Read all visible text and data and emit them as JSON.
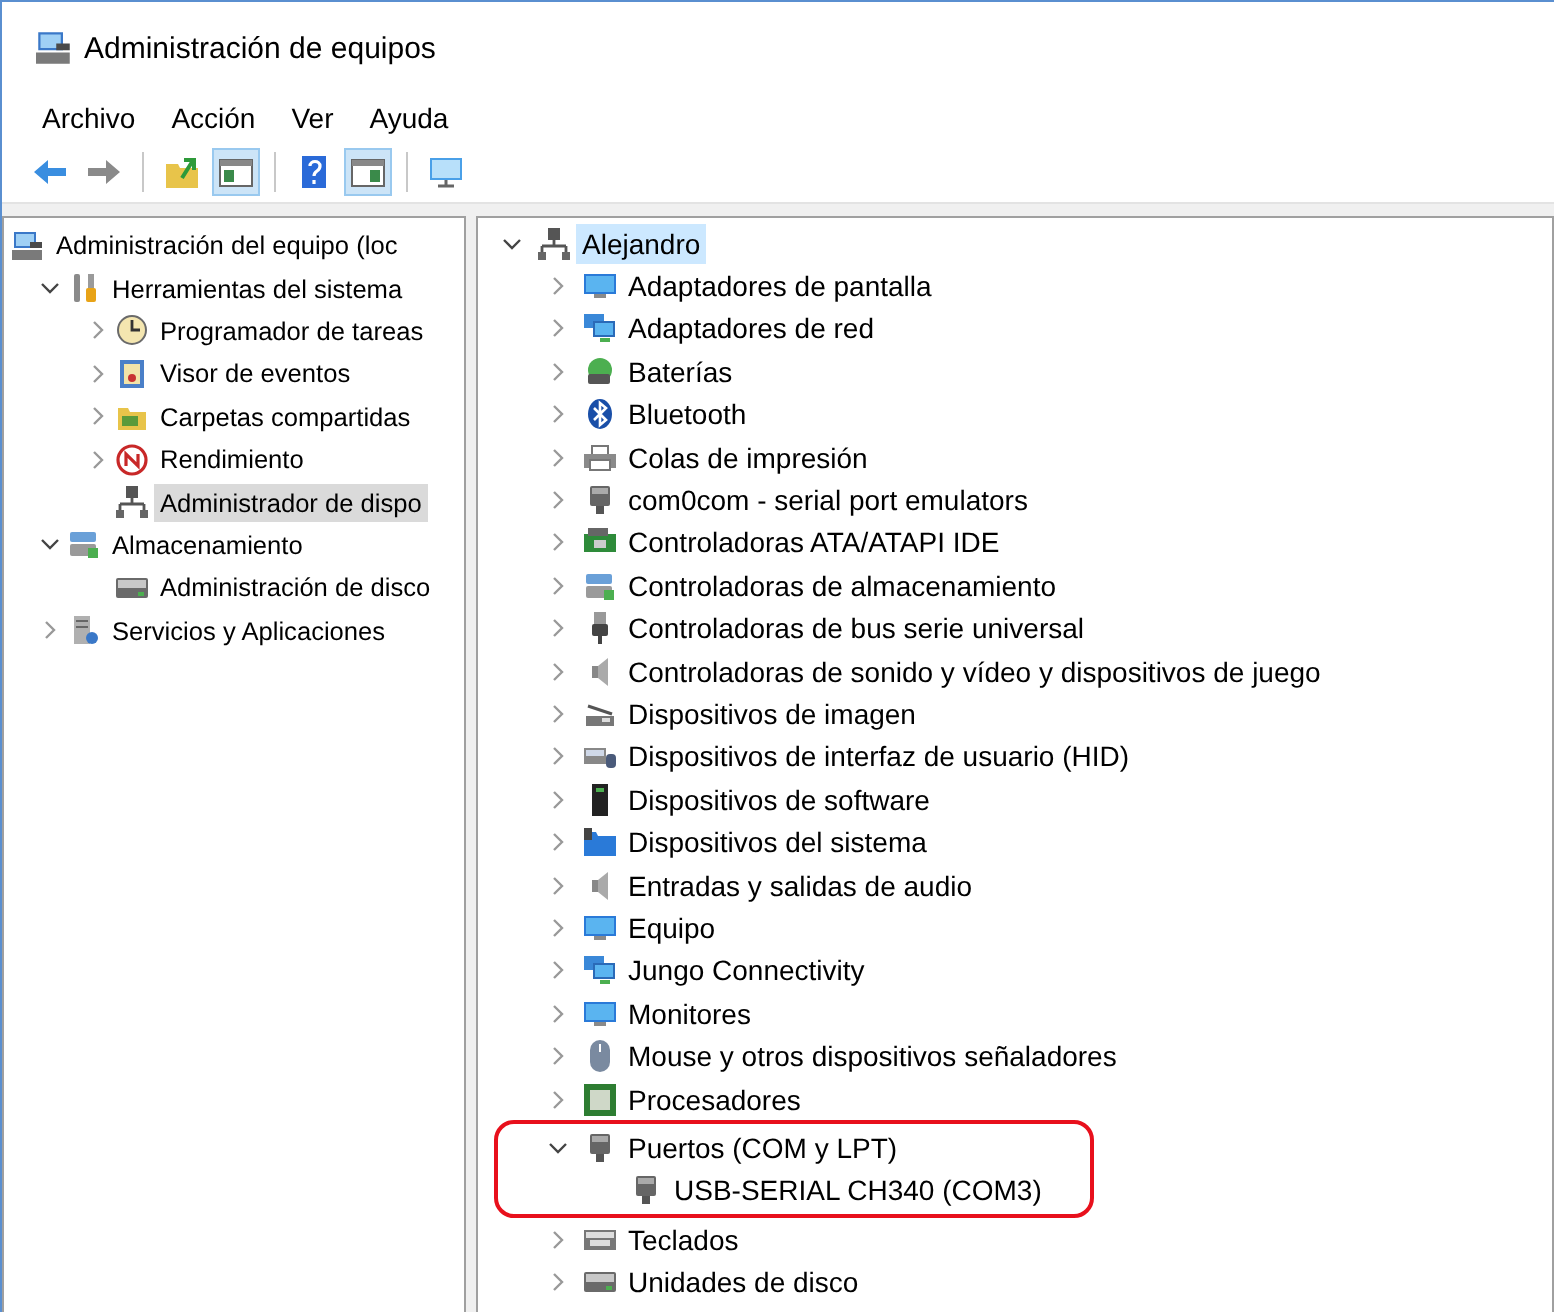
{
  "window": {
    "title": "Administración de equipos"
  },
  "menu": [
    "Archivo",
    "Acción",
    "Ver",
    "Ayuda"
  ],
  "toolbar": [
    {
      "kind": "back",
      "pressed": false
    },
    {
      "kind": "forward",
      "pressed": false
    },
    {
      "kind": "separator"
    },
    {
      "kind": "up",
      "pressed": false
    },
    {
      "kind": "tree",
      "pressed": true
    },
    {
      "kind": "separator"
    },
    {
      "kind": "help",
      "pressed": false
    },
    {
      "kind": "pane",
      "pressed": true
    },
    {
      "kind": "separator"
    },
    {
      "kind": "console",
      "pressed": false
    }
  ],
  "left_tree": [
    {
      "label": "Administración del equipo (loc",
      "kind": "computer",
      "selected": false,
      "children": [
        {
          "label": "Herramientas del sistema",
          "kind": "tools",
          "expanded": true,
          "selected": false,
          "children": [
            {
              "label": "Programador de tareas",
              "kind": "clock",
              "expanded": false,
              "selected": false
            },
            {
              "label": "Visor de eventos",
              "kind": "log",
              "expanded": false,
              "selected": false
            },
            {
              "label": "Carpetas compartidas",
              "kind": "share",
              "expanded": false,
              "selected": false
            },
            {
              "label": "Rendimiento",
              "kind": "perf",
              "expanded": false,
              "selected": false
            },
            {
              "label": "Administrador de dispo",
              "kind": "devmgr",
              "selected": true
            }
          ]
        },
        {
          "label": "Almacenamiento",
          "kind": "storage",
          "expanded": true,
          "selected": false,
          "children": [
            {
              "label": "Administración de disco",
              "kind": "drive",
              "selected": false
            }
          ]
        },
        {
          "label": "Servicios y Aplicaciones",
          "kind": "services",
          "expanded": false,
          "selected": false
        }
      ]
    }
  ],
  "device_tree": [
    {
      "label": "Alejandro",
      "kind": "devmgr",
      "expanded": true,
      "selected": true,
      "children": [
        {
          "label": "Adaptadores de pantalla",
          "kind": "display",
          "expanded": false,
          "selected": false,
          "highlighted": false
        },
        {
          "label": "Adaptadores de red",
          "kind": "network",
          "expanded": false,
          "selected": false,
          "highlighted": false
        },
        {
          "label": "Baterías",
          "kind": "battery",
          "expanded": false,
          "selected": false,
          "highlighted": false
        },
        {
          "label": "Bluetooth",
          "kind": "bluetooth",
          "expanded": false,
          "selected": false,
          "highlighted": false
        },
        {
          "label": "Colas de impresión",
          "kind": "printer",
          "expanded": false,
          "selected": false,
          "highlighted": false
        },
        {
          "label": "com0com - serial port emulators",
          "kind": "port",
          "expanded": false,
          "selected": false,
          "highlighted": false
        },
        {
          "label": "Controladoras ATA/ATAPI IDE",
          "kind": "card",
          "expanded": false,
          "selected": false,
          "highlighted": false
        },
        {
          "label": "Controladoras de almacenamiento",
          "kind": "storage",
          "expanded": false,
          "selected": false,
          "highlighted": false
        },
        {
          "label": "Controladoras de bus serie universal",
          "kind": "usb",
          "expanded": false,
          "selected": false,
          "highlighted": false
        },
        {
          "label": "Controladoras de sonido y vídeo y dispositivos de juego",
          "kind": "speaker",
          "expanded": false,
          "selected": false,
          "highlighted": false
        },
        {
          "label": "Dispositivos de imagen",
          "kind": "camera",
          "expanded": false,
          "selected": false,
          "highlighted": false
        },
        {
          "label": "Dispositivos de interfaz de usuario (HID)",
          "kind": "hid",
          "expanded": false,
          "selected": false,
          "highlighted": false
        },
        {
          "label": "Dispositivos de software",
          "kind": "tower",
          "expanded": false,
          "selected": false,
          "highlighted": false
        },
        {
          "label": "Dispositivos del sistema",
          "kind": "folder",
          "expanded": false,
          "selected": false,
          "highlighted": false
        },
        {
          "label": "Entradas y salidas de audio",
          "kind": "speaker",
          "expanded": false,
          "selected": false,
          "highlighted": false
        },
        {
          "label": "Equipo",
          "kind": "display",
          "expanded": false,
          "selected": false,
          "highlighted": false
        },
        {
          "label": "Jungo Connectivity",
          "kind": "network",
          "expanded": false,
          "selected": false,
          "highlighted": false
        },
        {
          "label": "Monitores",
          "kind": "display",
          "expanded": false,
          "selected": false,
          "highlighted": false
        },
        {
          "label": "Mouse y otros dispositivos señaladores",
          "kind": "mouse",
          "expanded": false,
          "selected": false,
          "highlighted": false
        },
        {
          "label": "Procesadores",
          "kind": "cpu",
          "expanded": false,
          "selected": false,
          "highlighted": false
        },
        {
          "label": "Puertos (COM y LPT)",
          "kind": "port",
          "expanded": true,
          "selected": false,
          "highlighted": true,
          "children": [
            {
              "label": "USB-SERIAL CH340 (COM3)",
              "kind": "port",
              "selected": false
            }
          ]
        },
        {
          "label": "Teclados",
          "kind": "keyboard",
          "expanded": false,
          "selected": false,
          "highlighted": false
        },
        {
          "label": "Unidades de disco",
          "kind": "drive",
          "expanded": false,
          "selected": false,
          "highlighted": false
        }
      ]
    }
  ]
}
